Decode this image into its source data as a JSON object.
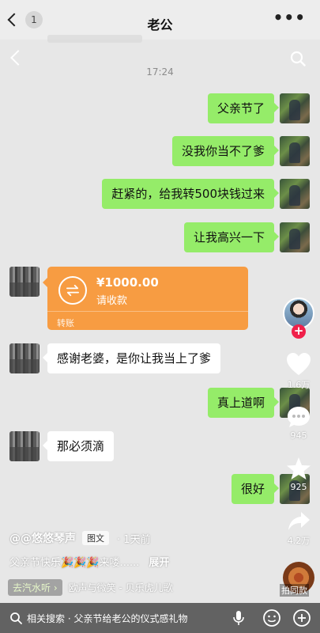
{
  "topbar": {
    "title": "老公",
    "badge": "1",
    "more": "•••"
  },
  "chat": {
    "time": "17:24",
    "messages": [
      {
        "side": "me",
        "text": "父亲节了"
      },
      {
        "side": "me",
        "text": "没我你当不了爹"
      },
      {
        "side": "me",
        "text": "赶紧的，给我转500块钱过来"
      },
      {
        "side": "me",
        "text": "让我高兴一下"
      },
      {
        "side": "wife",
        "text": "感谢老婆，是你让我当上了爹"
      },
      {
        "side": "me",
        "text": "真上道啊"
      },
      {
        "side": "wife",
        "text": "那必须滴"
      },
      {
        "side": "me",
        "text": "很好"
      }
    ],
    "transfer": {
      "amount": "¥1000.00",
      "status": "请收款",
      "label": "转账"
    }
  },
  "rail": {
    "likes": "1.6万",
    "comments": "945",
    "favorites": "925",
    "shares": "4.2万",
    "disc_label": "拍同款"
  },
  "post": {
    "author": "@@悠悠琴声",
    "tag": "图文",
    "ago": "· 1天前",
    "caption": "父亲节快乐🎉🎉🎉来喽......",
    "expand": "展开",
    "music_chip": "去汽水听 ›",
    "music": "欧声与微笑 - 贝乐虎儿歌"
  },
  "search": {
    "text": "相关搜索 · 父亲节给老公的仪式感礼物"
  },
  "colors": {
    "green_bubble": "#95ec69",
    "transfer": "#f79c42",
    "follow": "#f0204a"
  }
}
